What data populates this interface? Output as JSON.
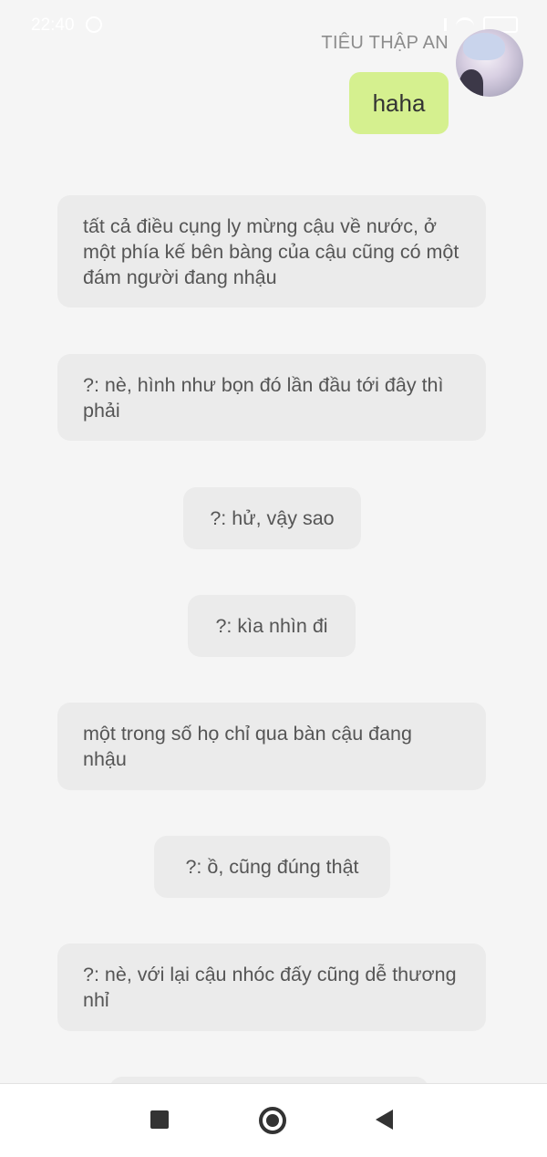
{
  "status_bar": {
    "time": "22:40"
  },
  "header": {
    "sender_name": "TIÊU THẬP AN"
  },
  "my_message": "haha",
  "messages": [
    "tất cả điều cụng ly mừng cậu về nước, ở một phía kế bên bàng của cậu cũng có một đám người đang nhậu",
    "?: nè, hình như bọn đó lần đầu tới đây thì phải",
    "?: hử, vậy sao",
    "?: kìa nhìn đi",
    "một trong số họ chỉ qua bàn cậu đang nhậu",
    "?: ồ, cũng đúng thật",
    "?: nè, với lại cậu nhóc đấy cũng dễ thương nhỉ"
  ],
  "nav": {
    "icons": [
      "stop-square-icon",
      "home-circle-icon",
      "back-triangle-icon"
    ]
  }
}
